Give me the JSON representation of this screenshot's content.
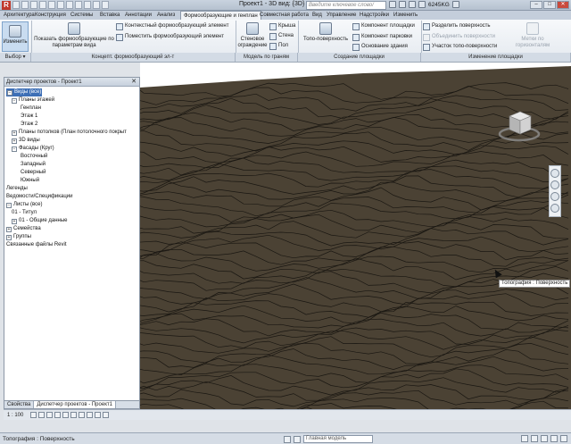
{
  "title_bar": {
    "title": "Проект1 - 3D вид: {3D}",
    "search_placeholder": "Введите ключевое слово/фразу",
    "user": "6245KG",
    "minimize": "–",
    "maximize": "□",
    "close": "✕"
  },
  "tabs": [
    {
      "label": "Архитектура"
    },
    {
      "label": "Конструкция"
    },
    {
      "label": "Системы"
    },
    {
      "label": "Вставка"
    },
    {
      "label": "Аннотации"
    },
    {
      "label": "Анализ"
    },
    {
      "label": "Формообразующие и генплан",
      "active": true
    },
    {
      "label": "Совместная работа"
    },
    {
      "label": "Вид"
    },
    {
      "label": "Управление"
    },
    {
      "label": "Надстройки"
    },
    {
      "label": "Изменить"
    }
  ],
  "ribbon": {
    "select": {
      "button": "Изменить",
      "group": "Выбор ▾"
    },
    "conceptual": {
      "show_button": "Показать формообразующие по параметрам вида",
      "context_button": "Контекстный формообразующий элемент",
      "place_button": "Поместить формообразующий элемент",
      "group": "Концепт. формообразующий эл-т"
    },
    "model_by_face": {
      "curtain_system": "Стеновое ограждение",
      "roof": "Крыша",
      "wall": "Стена",
      "floor": "Пол",
      "group": "Модель по граням"
    },
    "site": {
      "toposurface": "Топо-поверхность",
      "site_component": "Компонент площадки",
      "parking_component": "Компонент парковки",
      "building_pad": "Основание здания",
      "group": "Создание площадки"
    },
    "modify_site": {
      "split_surface": "Разделить поверхность",
      "merge_surfaces": "Объединить поверхности",
      "subregion": "Участок топо-поверхности",
      "label_contours": "Метки по горизонталям",
      "group": "Изменение площадки"
    }
  },
  "project_browser": {
    "title": "Диспетчер проектов - Проект1",
    "close": "✕",
    "nodes": [
      {
        "label": "Виды (все)",
        "sym": "−"
      },
      {
        "label": "Планы этажей",
        "sym": "−"
      },
      {
        "label": "Генплан",
        "sym": ""
      },
      {
        "label": "Этаж 1",
        "sym": ""
      },
      {
        "label": "Этаж 2",
        "sym": ""
      },
      {
        "label": "Планы потолков (План потолочного покрыт",
        "sym": "+"
      },
      {
        "label": "3D виды",
        "sym": "+"
      },
      {
        "label": "Фасады (Круг)",
        "sym": "−"
      },
      {
        "label": "Восточный",
        "sym": ""
      },
      {
        "label": "Западный",
        "sym": ""
      },
      {
        "label": "Северный",
        "sym": ""
      },
      {
        "label": "Южный",
        "sym": ""
      },
      {
        "label": "Легенды",
        "sym": ""
      },
      {
        "label": "Ведомости/Спецификации",
        "sym": ""
      },
      {
        "label": "Листы (все)",
        "sym": "−"
      },
      {
        "label": "01 - Титул",
        "sym": ""
      },
      {
        "label": "01 - Общие данные",
        "sym": "+"
      },
      {
        "label": "Семейства",
        "sym": "+"
      },
      {
        "label": "Группы",
        "sym": "+"
      },
      {
        "label": "Связанные файлы Revit",
        "sym": ""
      }
    ],
    "footer_tabs": [
      {
        "label": "Свойства"
      },
      {
        "label": "Диспетчер проектов - Проект1",
        "active": true
      }
    ]
  },
  "viewport": {
    "tooltip": "Топография : Поверхность",
    "surface_color": "#4b4234",
    "contour_color": "#1a1712"
  },
  "view_control": {
    "scale": "1 : 100"
  },
  "status_bar": {
    "text": "Топография : Поверхность",
    "model": "Главная модель",
    "filter_count": ":0"
  }
}
